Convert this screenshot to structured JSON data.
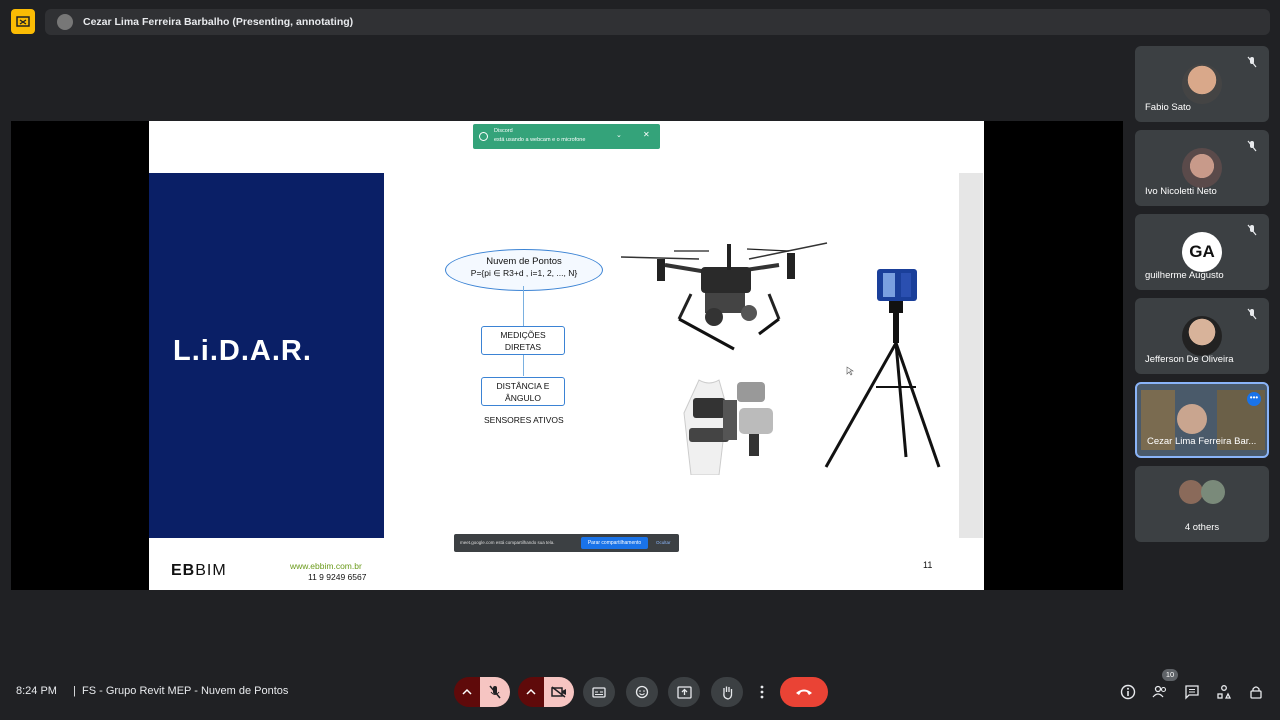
{
  "topbar": {
    "presenter_label": "Cezar Lima Ferreira Barbalho (Presenting, annotating)"
  },
  "slide": {
    "title": "L.i.D.A.R.",
    "cloud_line1": "Nuvem de Pontos",
    "cloud_line2": "P={pi ∈ R3+d , i=1, 2, ..., N}",
    "box1": "MEDIÇÕES DIRETAS",
    "box2": "DISTÂNCIA E ÂNGULO",
    "sensores": "SENSORES ATIVOS",
    "logo_bold": "EB",
    "logo_rest": "BIM",
    "website": "www.ebbim.com.br",
    "phone": "11 9 9249 6567",
    "page_number": "11",
    "discord_title": "Discord",
    "discord_msg": "está usando a webcam e o microfone",
    "share_msg": "meet.google.com está compartilhando sua tela.",
    "share_stop": "Parar compartilhamento",
    "share_hide": "Ocultar"
  },
  "participants": [
    {
      "name": "Fabio Sato"
    },
    {
      "name": "Ivo Nicoletti Neto"
    },
    {
      "name": "guilherme Augusto",
      "avatar_text": "GA"
    },
    {
      "name": "Jefferson De Oliveira"
    },
    {
      "name": "Cezar Lima Ferreira Bar..."
    },
    {
      "name": "4 others"
    }
  ],
  "bottombar": {
    "time": "8:24 PM",
    "meeting_title": "FS - Grupo Revit MEP - Nuvem de Pontos",
    "people_count": "10"
  },
  "colors": {
    "background": "#202124",
    "slide_blue": "#0a1f66",
    "end_call": "#ea4335",
    "present_accent": "#fbbc04",
    "discord_green": "#34a37a"
  }
}
